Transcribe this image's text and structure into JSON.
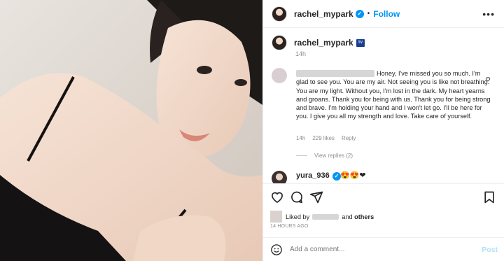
{
  "header": {
    "username": "rachel_mypark",
    "separator": "•",
    "follow_label": "Follow",
    "more_label": "•••"
  },
  "caption": {
    "username": "rachel_mypark",
    "tv_badge": "TV",
    "time": "14h"
  },
  "comment1": {
    "text": "Honey, I've missed you so much. I'm glad to see you. You are my air. Not seeing you is like not breathing. You are my light. Without you, I'm lost in the dark. My heart yearns and groans. Thank you for being with us. Thank you for being strong and brave. I'm holding your hand and I won't let go. I'll be here for you. I give you all my strength and love. Take care of yourself.",
    "time": "14h",
    "likes": "229 likes",
    "reply": "Reply",
    "view_replies": "View replies (2)"
  },
  "comment2": {
    "username": "yura_936",
    "emojis": "😍😍❤"
  },
  "likes": {
    "prefix": "Liked by",
    "suffix_and": "and",
    "others": "others"
  },
  "timestamp": "14 HOURS AGO",
  "add_comment": {
    "placeholder": "Add a comment...",
    "post_label": "Post"
  },
  "colors": {
    "accent": "#0095f6",
    "post_disabled": "#b2dffc",
    "heart_red": "#ed4956"
  },
  "icons": [
    "verified-badge-icon",
    "more-icon",
    "heart-icon",
    "comment-icon",
    "share-icon",
    "bookmark-icon",
    "emoji-icon"
  ]
}
